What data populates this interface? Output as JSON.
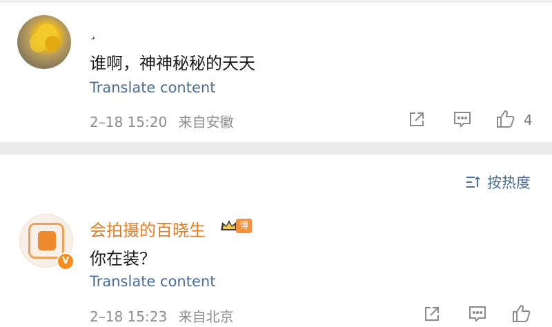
{
  "comments": [
    {
      "username": "¸",
      "text": "谁啊，神神秘秘的天天",
      "translate_label": "Translate content",
      "time": "2–18 15:20",
      "source": "来自安徽",
      "likes": "4"
    },
    {
      "username": "会拍摄的百晓生",
      "badge": "博主",
      "text": "你在装？",
      "translate_label": "Translate content",
      "time": "2–18 15:23",
      "source": "来自北京",
      "verified_mark": "V"
    }
  ],
  "sort": {
    "label": "按热度"
  },
  "colors": {
    "link": "#4a6d95",
    "vip_name": "#e87c1e",
    "meta": "#8c8c8c",
    "divider": "#ececec"
  },
  "icons": [
    "share-icon",
    "comment-icon",
    "like-icon",
    "sort-icon",
    "crown-icon"
  ]
}
